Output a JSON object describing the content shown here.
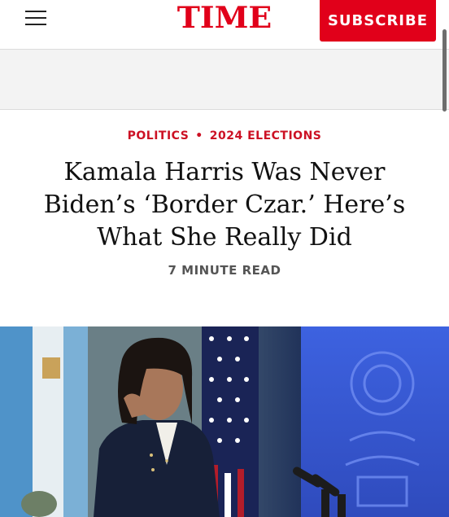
{
  "header": {
    "logo": "TIME",
    "subscribe_label": "SUBSCRIBE",
    "brand_color": "#e1001a"
  },
  "article": {
    "section": "POLITICS",
    "subsection": "2024 ELECTIONS",
    "separator": "•",
    "headline": "Kamala Harris Was Never Biden’s ‘Border Czar.’ Here’s What She Really Did",
    "read_time": "7 MINUTE READ"
  },
  "icons": {
    "menu": "hamburger-menu-icon"
  }
}
